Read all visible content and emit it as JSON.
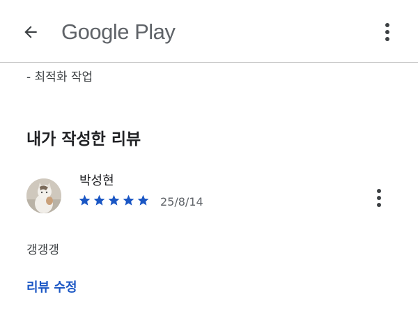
{
  "app_bar": {
    "title": "Google Play",
    "back_icon": "arrow-back-icon",
    "menu_icon": "more-vert-icon"
  },
  "content": {
    "optimize_line": "- 최적화 작업",
    "section_title": "내가 작성한 리뷰"
  },
  "review": {
    "reviewer_name": "박성현",
    "rating": 5,
    "rating_max": 5,
    "date": "25/8/14",
    "text": "갱갱갱",
    "menu_icon": "more-vert-icon"
  },
  "actions": {
    "edit_review_label": "리뷰 수정"
  },
  "colors": {
    "star": "#1a56c4",
    "link": "#1a56c4",
    "title_gray": "#5f6368",
    "divider": "#c8c8c8"
  }
}
